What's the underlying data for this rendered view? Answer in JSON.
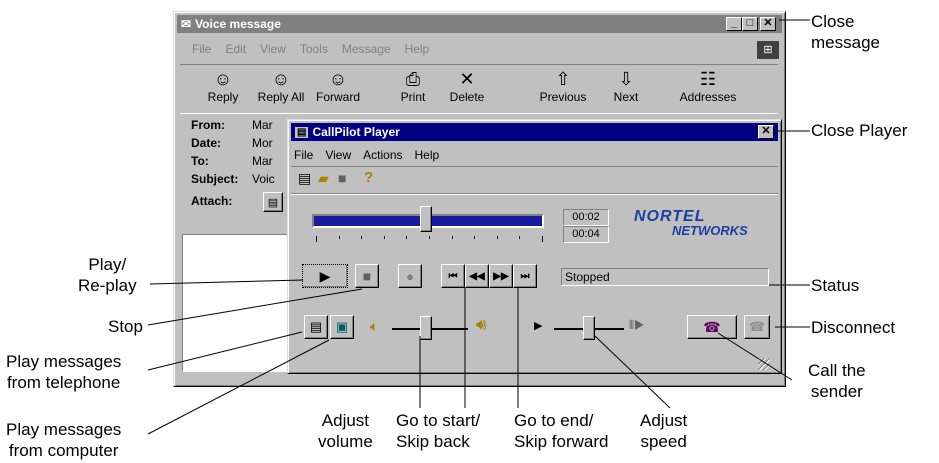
{
  "voice_window": {
    "title": "Voice message",
    "menu": [
      "File",
      "Edit",
      "View",
      "Tools",
      "Message",
      "Help"
    ],
    "toolbar": [
      {
        "label": "Reply",
        "icon": "reply-icon",
        "glyph": "☺"
      },
      {
        "label": "Reply All",
        "icon": "reply-all-icon",
        "glyph": "☺"
      },
      {
        "label": "Forward",
        "icon": "forward-icon",
        "glyph": "☺"
      },
      {
        "label": "Print",
        "icon": "print-icon",
        "glyph": "⎙"
      },
      {
        "label": "Delete",
        "icon": "delete-icon",
        "glyph": "✕"
      },
      {
        "label": "Previous",
        "icon": "previous-icon",
        "glyph": "⇧"
      },
      {
        "label": "Next",
        "icon": "next-icon",
        "glyph": "⇩"
      },
      {
        "label": "Addresses",
        "icon": "addresses-icon",
        "glyph": "☷"
      }
    ],
    "header": {
      "from_label": "From:",
      "from_value": "Mar",
      "date_label": "Date:",
      "date_value": "Mor",
      "to_label": "To:",
      "to_value": "Mar",
      "subject_label": "Subject:",
      "subject_value": "Voic",
      "attach_label": "Attach:"
    }
  },
  "player": {
    "title": "CallPilot Player",
    "menu": [
      "File",
      "View",
      "Actions",
      "Help"
    ],
    "elapsed": "00:02",
    "total": "00:04",
    "position_fraction": 0.49,
    "brand_top": "NORTEL",
    "brand_bottom": "NETWORKS",
    "status": "Stopped",
    "volume_fraction": 0.45,
    "speed_fraction": 0.5
  },
  "callouts": {
    "close_message": "Close\nmessage",
    "close_player": "Close Player",
    "status": "Status",
    "disconnect": "Disconnect",
    "call_sender": "Call the\nsender",
    "play_replay": "Play/\nRe-play",
    "stop": "Stop",
    "play_phone": "Play messages\nfrom telephone",
    "play_computer": "Play messages\nfrom computer",
    "adjust_volume": "Adjust\nvolume",
    "go_start": "Go to start/\nSkip back",
    "go_end": "Go to end/\nSkip forward",
    "adjust_speed": "Adjust\nspeed"
  },
  "colors": {
    "title_active": "#000080",
    "title_inactive": "#808080",
    "face": "#c0c0c0",
    "brand": "#1f3fa0"
  }
}
